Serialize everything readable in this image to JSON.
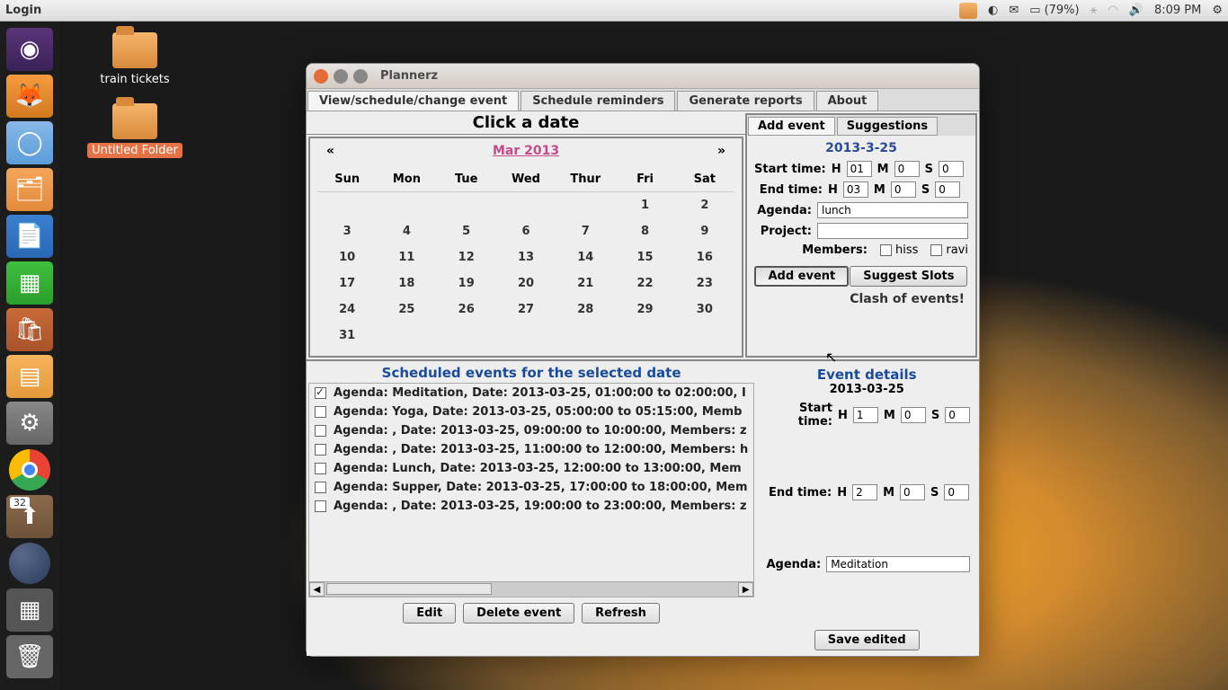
{
  "top_panel": {
    "menu": "Login",
    "battery": "(79%)",
    "time": "8:09 PM"
  },
  "desktop_icons": {
    "i1": "train tickets",
    "i2": "Untitled Folder"
  },
  "launcher_badge": "32",
  "window": {
    "title": "Plannerz",
    "tabs": {
      "t1": "View/schedule/change event",
      "t2": "Schedule reminders",
      "t3": "Generate reports",
      "t4": "About"
    }
  },
  "calendar": {
    "title": "Click a date",
    "prev": "«",
    "next": "»",
    "month": "Mar 2013",
    "days": {
      "d0": "Sun",
      "d1": "Mon",
      "d2": "Tue",
      "d3": "Wed",
      "d4": "Thur",
      "d5": "Fri",
      "d6": "Sat"
    },
    "cells": {
      "r0": {
        "c5": "1",
        "c6": "2"
      },
      "r1": {
        "c0": "3",
        "c1": "4",
        "c2": "5",
        "c3": "6",
        "c4": "7",
        "c5": "8",
        "c6": "9"
      },
      "r2": {
        "c0": "10",
        "c1": "11",
        "c2": "12",
        "c3": "13",
        "c4": "14",
        "c5": "15",
        "c6": "16"
      },
      "r3": {
        "c0": "17",
        "c1": "18",
        "c2": "19",
        "c3": "20",
        "c4": "21",
        "c5": "22",
        "c6": "23"
      },
      "r4": {
        "c0": "24",
        "c1": "25",
        "c2": "26",
        "c3": "27",
        "c4": "28",
        "c5": "29",
        "c6": "30"
      },
      "r5": {
        "c0": "31"
      }
    }
  },
  "add_event": {
    "tabs": {
      "t1": "Add event",
      "t2": "Suggestions"
    },
    "date": "2013-3-25",
    "start_label": "Start time:",
    "end_label": "End time:",
    "h": "H",
    "m": "M",
    "s": "S",
    "start_h": "01",
    "start_m": "0",
    "start_s": "0",
    "end_h": "03",
    "end_m": "0",
    "end_s": "0",
    "agenda_label": "Agenda:",
    "agenda_value": "lunch",
    "project_label": "Project:",
    "project_value": "",
    "members_label": "Members:",
    "member1": "hiss",
    "member2": "ravi",
    "btn_add": "Add event",
    "btn_suggest": "Suggest Slots",
    "warning": "Clash of events!"
  },
  "events": {
    "title": "Scheduled events for the selected date",
    "items": {
      "e0": "Agenda: Meditation, Date: 2013-03-25, 01:00:00 to 02:00:00, I",
      "e1": "Agenda: Yoga, Date: 2013-03-25, 05:00:00 to 05:15:00, Memb",
      "e2": "Agenda: , Date: 2013-03-25, 09:00:00 to 10:00:00, Members: z",
      "e3": "Agenda: , Date: 2013-03-25, 11:00:00 to 12:00:00, Members: h",
      "e4": "Agenda: Lunch, Date: 2013-03-25, 12:00:00 to 13:00:00, Mem",
      "e5": "Agenda: Supper, Date: 2013-03-25, 17:00:00 to 18:00:00, Mem",
      "e6": "Agenda: , Date: 2013-03-25, 19:00:00 to 23:00:00, Members: z"
    },
    "btn_edit": "Edit",
    "btn_delete": "Delete event",
    "btn_refresh": "Refresh"
  },
  "details": {
    "title": "Event details",
    "date": "2013-03-25",
    "start_label": "Start time:",
    "end_label": "End time:",
    "h": "H",
    "m": "M",
    "s": "S",
    "start_h": "1",
    "start_m": "0",
    "start_s": "0",
    "end_h": "2",
    "end_m": "0",
    "end_s": "0",
    "agenda_label": "Agenda:",
    "agenda_value": "Meditation",
    "btn_save": "Save edited"
  }
}
